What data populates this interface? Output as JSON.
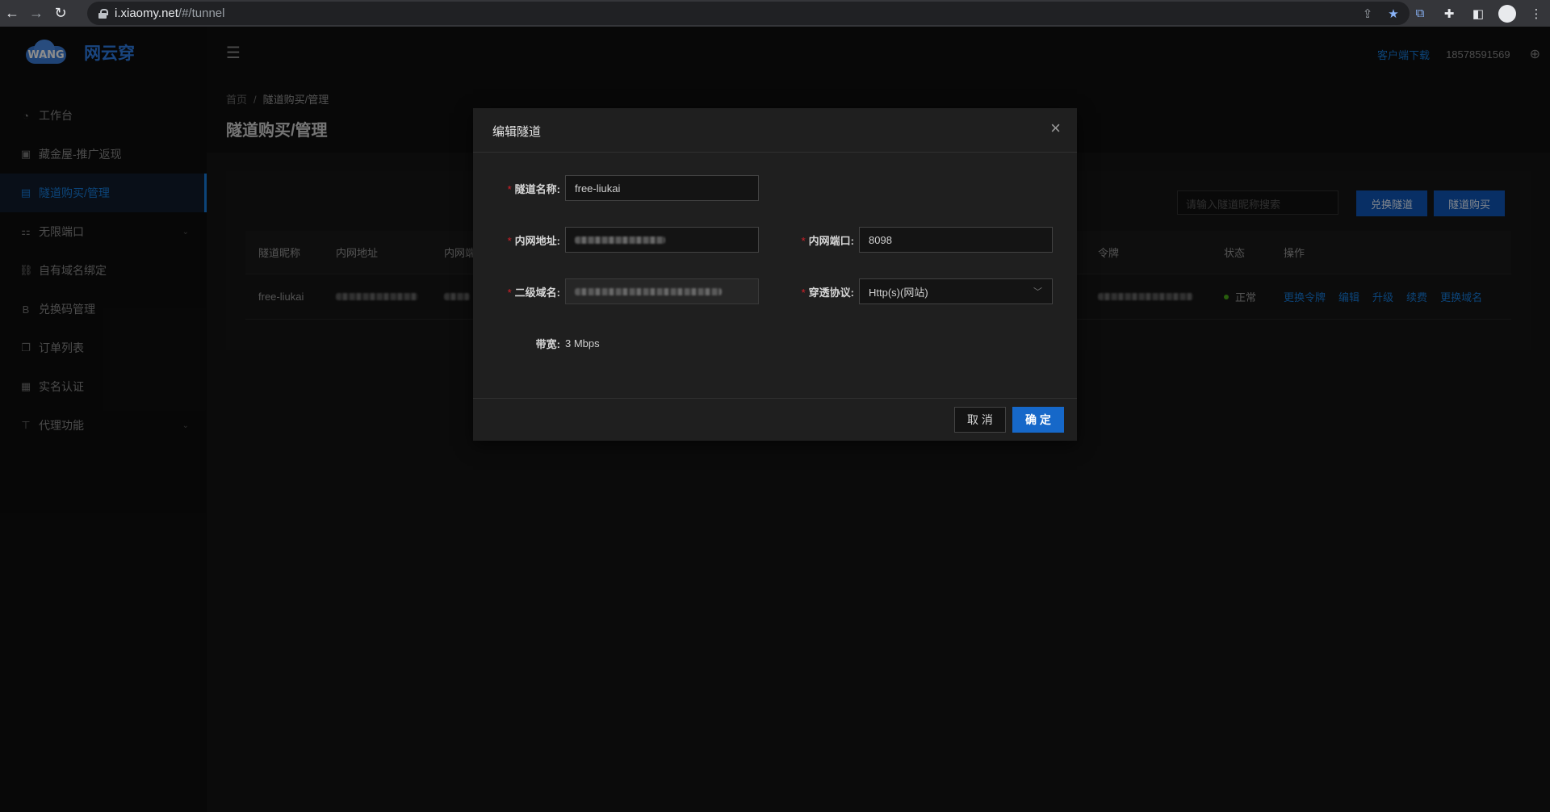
{
  "browser": {
    "url_host": "i.xiaomy.net",
    "url_path": "/#/tunnel"
  },
  "sidebar": {
    "brand_logo_text": "WANG",
    "brand_name": "网云穿",
    "items": [
      {
        "label": "工作台",
        "icon": "dashboard-icon",
        "glyph": "◔"
      },
      {
        "label": "藏金屋-推广返现",
        "icon": "gift-icon",
        "glyph": "▣"
      },
      {
        "label": "隧道购买/管理",
        "icon": "tunnel-icon",
        "glyph": "▤",
        "active": true
      },
      {
        "label": "无限端口",
        "icon": "cluster-icon",
        "glyph": "⚏",
        "has_arrow": true
      },
      {
        "label": "自有域名绑定",
        "icon": "link-icon",
        "glyph": "⛓"
      },
      {
        "label": "兑换码管理",
        "icon": "bold-icon",
        "glyph": "B"
      },
      {
        "label": "订单列表",
        "icon": "copy-icon",
        "glyph": "❐"
      },
      {
        "label": "实名认证",
        "icon": "idcard-icon",
        "glyph": "▦"
      },
      {
        "label": "代理功能",
        "icon": "agent-icon",
        "glyph": "⊤",
        "has_arrow": true
      }
    ]
  },
  "header": {
    "client_download": "客户端下载",
    "phone": "18578591569"
  },
  "breadcrumb": {
    "home": "首页",
    "separator": "/",
    "current": "隧道购买/管理"
  },
  "page_title": "隧道购买/管理",
  "toolbar": {
    "search_placeholder": "请输入隧道昵称搜索",
    "exchange_button": "兑换隧道",
    "buy_button": "隧道购买"
  },
  "table": {
    "headers": {
      "name": "隧道昵称",
      "local_addr": "内网地址",
      "local_port": "内网端",
      "token": "令牌",
      "status": "状态",
      "actions": "操作"
    },
    "row": {
      "name": "free-liukai",
      "status": "正常",
      "actions": [
        "更换令牌",
        "编辑",
        "升级",
        "续费",
        "更换域名"
      ]
    }
  },
  "modal": {
    "title": "编辑隧道",
    "fields": {
      "tunnel_name_label": "隧道名称:",
      "tunnel_name_value": "free-liukai",
      "local_addr_label": "内网地址:",
      "local_port_label": "内网端口:",
      "local_port_value": "8098",
      "subdomain_label": "二级域名:",
      "protocol_label": "穿透协议:",
      "protocol_value": "Http(s)(网站)",
      "bandwidth_label": "带宽:",
      "bandwidth_value": "3 Mbps"
    },
    "cancel": "取 消",
    "confirm": "确 定"
  }
}
